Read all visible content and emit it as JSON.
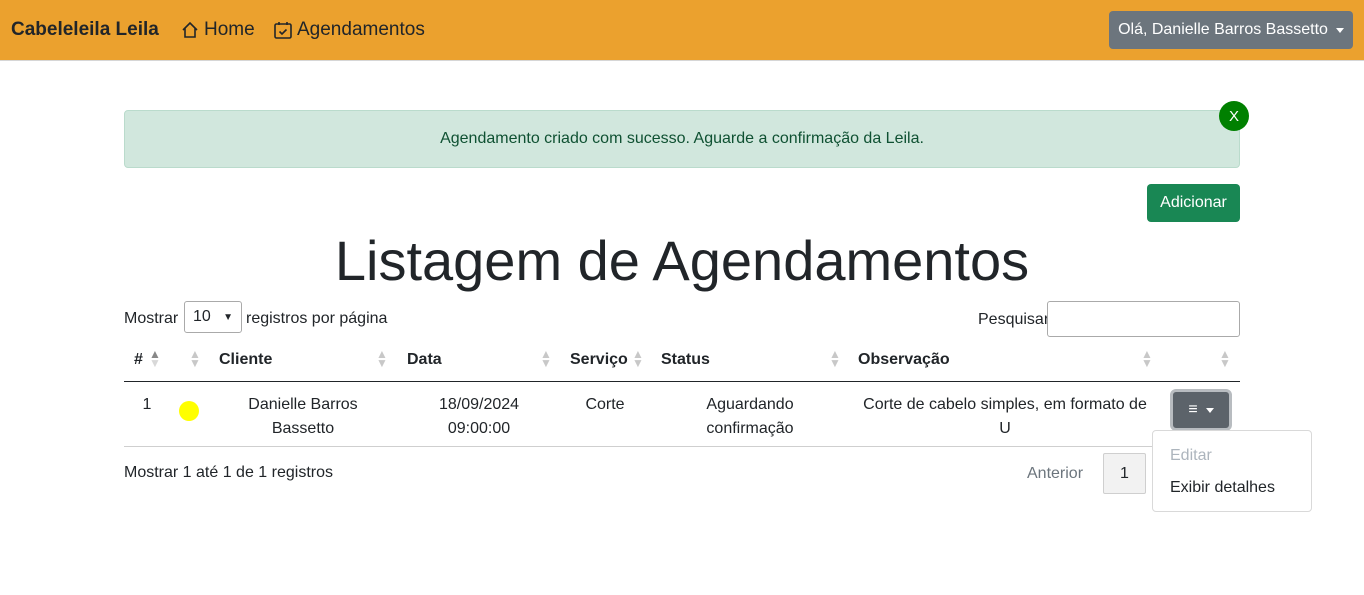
{
  "navbar": {
    "brand": "Cabeleleila Leila",
    "home_label": "Home",
    "agendamentos_label": "Agendamentos",
    "user_greeting": "Olá, Danielle Barros Bassetto"
  },
  "alert": {
    "message": "Agendamento criado com sucesso. Aguarde a confirmação da Leila.",
    "close_label": "X"
  },
  "toolbar": {
    "add_label": "Adicionar"
  },
  "page_title": "Listagem de Agendamentos",
  "length_control": {
    "prefix": "Mostrar",
    "value": "10",
    "suffix": "registros por página"
  },
  "search": {
    "label": "Pesquisar",
    "value": ""
  },
  "table": {
    "headers": [
      "#",
      "",
      "Cliente",
      "Data",
      "Serviço",
      "Status",
      "Observação",
      ""
    ],
    "rows": [
      {
        "id": "1",
        "status_color": "#ffff00",
        "cliente_line1": "Danielle Barros",
        "cliente_line2": "Bassetto",
        "data_line1": "18/09/2024",
        "data_line2": "09:00:00",
        "servico": "Corte",
        "status_line1": "Aguardando",
        "status_line2": "confirmação",
        "observacao_line1": "Corte de cabelo simples, em formato de",
        "observacao_line2": "U"
      }
    ]
  },
  "row_menu": {
    "items": [
      "Editar",
      "Exibir detalhes"
    ],
    "disabled": [
      "Editar"
    ]
  },
  "footer": {
    "info": "Mostrar 1 até 1 de 1 registros",
    "prev_label": "Anterior",
    "current_page": "1"
  },
  "colors": {
    "navbar": "#eba12e",
    "add_button": "#198754",
    "alert_close": "#008000"
  }
}
